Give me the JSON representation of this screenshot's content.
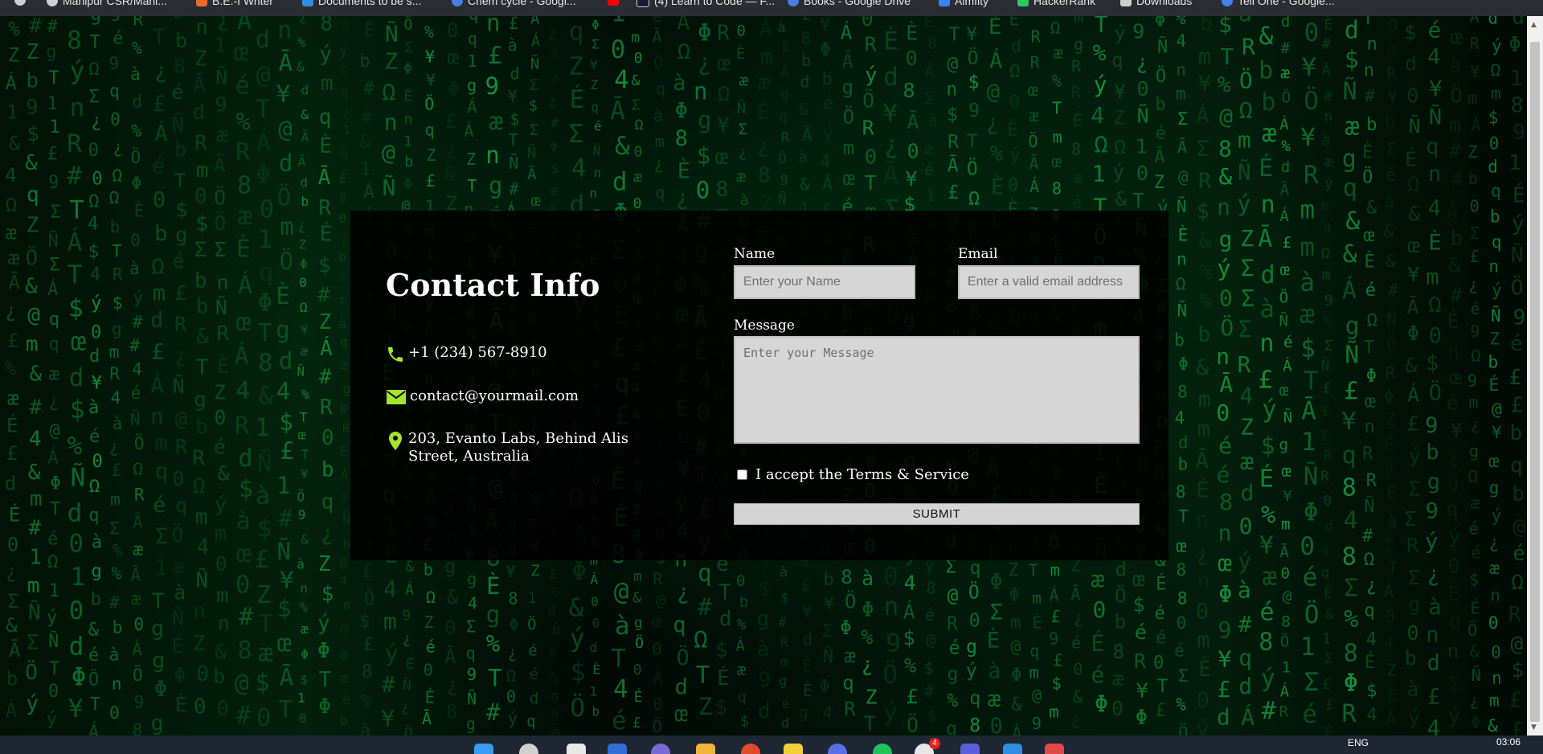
{
  "browser": {
    "bookmarks": [
      {
        "label": "Manipur CSR/Mani...",
        "color": "#cfcfcf"
      },
      {
        "label": "B.E.-I Writer",
        "color": "#e86a2a"
      },
      {
        "label": "Documents to be s...",
        "color": "#2f8de4"
      },
      {
        "label": "Chem cycle - Googl...",
        "color": "#4a7ee8"
      },
      {
        "label": "",
        "color": "#ff0000"
      },
      {
        "label": "(4) Learn to Code — F...",
        "color": "#1b1b32"
      },
      {
        "label": "Books - Google Drive",
        "color": "#4a7ee8"
      },
      {
        "label": "Aimfity",
        "color": "#3b82f6"
      },
      {
        "label": "HackerRank",
        "color": "#2ec866"
      },
      {
        "label": "Downloads",
        "color": "#cfcfcf"
      },
      {
        "label": "Tell One - Google...",
        "color": "#4a7ee8"
      }
    ]
  },
  "contact": {
    "title": "Contact Info",
    "phone": "+1 (234) 567-8910",
    "email": "contact@yourmail.com",
    "address": "203, Evanto Labs, Behind Alis Street, Australia",
    "accent_color": "#a4e32e"
  },
  "form": {
    "name_label": "Name",
    "name_placeholder": "Enter your Name",
    "email_label": "Email",
    "email_placeholder": "Enter a valid email address",
    "message_label": "Message",
    "message_placeholder": "Enter your Message",
    "terms_label": "I accept the Terms & Service",
    "terms_checked": false,
    "submit_label": "SUBMIT"
  },
  "taskbar": {
    "language": "ENG",
    "time": "03:06",
    "notification_count": "4"
  },
  "theme": {
    "background": "#020a04",
    "matrix_green": "#1fd15a",
    "card_bg": "rgba(0,0,0,0.86)",
    "input_bg": "#d6d6d6"
  }
}
